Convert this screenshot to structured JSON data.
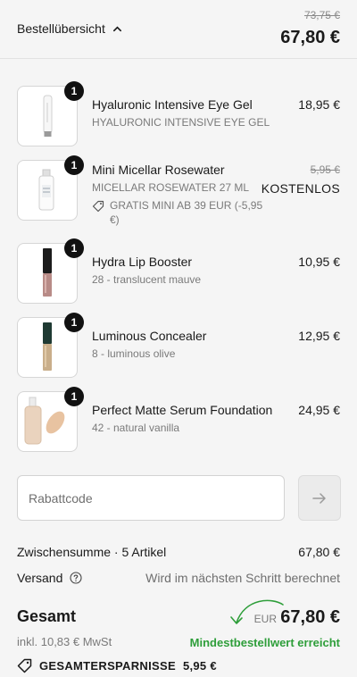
{
  "header": {
    "toggle_label": "Bestellübersicht",
    "old_total": "73,75 €",
    "total": "67,80 €"
  },
  "items": [
    {
      "quantity": "1",
      "name": "Hyaluronic Intensive Eye Gel",
      "variant": "HYALURONIC INTENSIVE EYE GEL",
      "price": "18,95 €"
    },
    {
      "quantity": "1",
      "name": "Mini Micellar Rosewater",
      "variant": "MICELLAR ROSEWATER 27 ML",
      "price_old": "5,95 €",
      "price": "KOSTENLOS",
      "discount": "GRATIS MINI AB 39 EUR (-5,95 €)"
    },
    {
      "quantity": "1",
      "name": "Hydra Lip Booster",
      "variant": "28 - translucent mauve",
      "price": "10,95 €"
    },
    {
      "quantity": "1",
      "name": "Luminous Concealer",
      "variant": "8 - luminous olive",
      "price": "12,95 €"
    },
    {
      "quantity": "1",
      "name": "Perfect Matte Serum Foundation",
      "variant": "42 - natural vanilla",
      "price": "24,95 €"
    }
  ],
  "coupon": {
    "placeholder": "Rabattcode"
  },
  "summary": {
    "subtotal_label": "Zwischensumme · 5 Artikel",
    "subtotal_value": "67,80 €",
    "shipping_label": "Versand",
    "shipping_value": "Wird im nächsten Schritt berechnet",
    "total_label": "Gesamt",
    "tax_note": "inkl. 10,83 € MwSt",
    "currency": "EUR",
    "total_value": "67,80 €",
    "min_order_note": "Mindestbestellwert erreicht",
    "savings_label": "GESAMTERSPARNISSE",
    "savings_value": "5,95 €"
  },
  "colors": {
    "accent_green": "#2e9e3a",
    "background": "#f5f5f5"
  }
}
